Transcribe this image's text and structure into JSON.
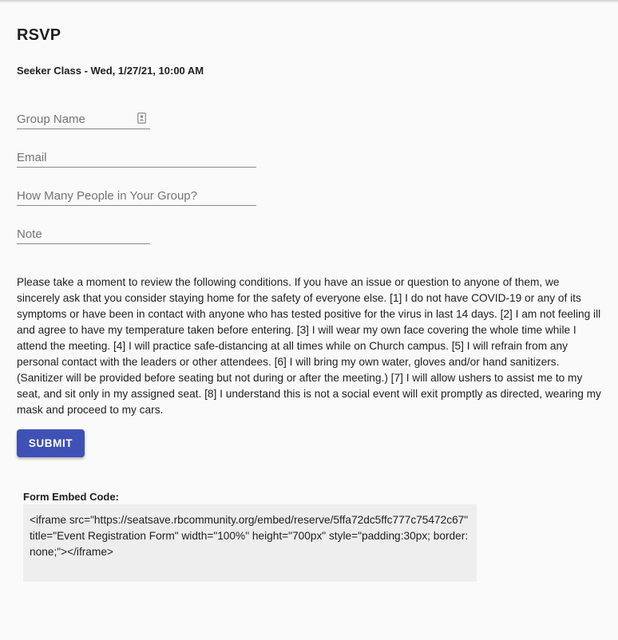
{
  "page": {
    "title": "RSVP",
    "event": "Seeker Class - Wed, 1/27/21, 10:00 AM"
  },
  "form": {
    "group_name_placeholder": "Group Name",
    "email_placeholder": "Email",
    "people_placeholder": "How Many People in Your Group?",
    "note_placeholder": "Note",
    "conditions": "Please take a moment to review the following conditions. If you have an issue or question to anyone of them, we sincerely ask that you consider staying home for the safety of everyone else. [1] I do not have COVID-19 or any of its symptoms or have been in contact with anyone who has tested positive for the virus in last 14 days. [2] I am not feeling ill and agree to have my temperature taken before entering. [3] I will wear my own face covering the whole time while I attend the meeting. [4] I will practice safe-distancing at all times while on Church campus. [5] I will refrain from any personal contact with the leaders or other attendees. [6] I will bring my own water, gloves and/or hand sanitizers. (Sanitizer will be provided before seating but not during or after the meeting.) [7] I will allow ushers to assist me to my seat, and sit only in my assigned seat. [8] I understand this is not a social event will exit promptly as directed, wearing my mask and proceed to my cars.",
    "submit_label": "SUBMIT"
  },
  "embed": {
    "label": "Form Embed Code:",
    "code": "<iframe src=\"https://seatsave.rbcommunity.org/embed/reserve/5ffa72dc5ffc777c75472c67\" title=\"Event Registration Form\" width=\"100%\" height=\"700px\" style=\"padding:30px; border:none;\"></iframe>"
  },
  "icons": {
    "group_field_icon": "contact-card-icon"
  },
  "colors": {
    "primary": "#3f51b5",
    "background": "#fafafa",
    "code_background": "#eeeeee"
  }
}
